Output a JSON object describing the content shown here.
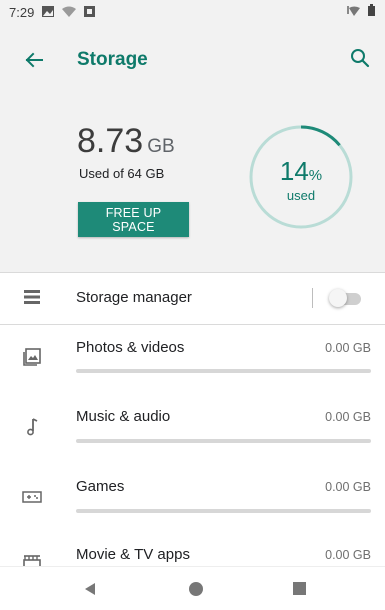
{
  "status_bar": {
    "time": "7:29",
    "icons": [
      "image-icon",
      "wifi-icon",
      "notification-icon",
      "signal-icon",
      "battery-icon"
    ]
  },
  "header": {
    "title": "Storage",
    "back_icon": "arrow-left-icon",
    "search_icon": "search-icon",
    "accent_color": "#0e7a6a",
    "background": "#f2f2f2"
  },
  "summary": {
    "used_value": "8.73",
    "used_unit": "GB",
    "used_of": "Used of 64 GB",
    "button_label": "FREE UP SPACE",
    "button_color": "#1e8a78",
    "percent_value": "14",
    "percent_sign": "%",
    "percent_label": "used",
    "percent_fraction": 0.14,
    "ring_track_color": "#b9dcd6",
    "ring_fill_color": "#1e8a78"
  },
  "storage_manager": {
    "label": "Storage manager",
    "icon": "storage-list-icon",
    "enabled": false
  },
  "categories": [
    {
      "label": "Photos & videos",
      "size": "0.00 GB",
      "icon": "photo-icon",
      "fraction": 0
    },
    {
      "label": "Music & audio",
      "size": "0.00 GB",
      "icon": "music-note-icon",
      "fraction": 0
    },
    {
      "label": "Games",
      "size": "0.00 GB",
      "icon": "gamepad-icon",
      "fraction": 0
    },
    {
      "label": "Movie & TV apps",
      "size": "0.00 GB",
      "icon": "movie-icon",
      "fraction": 0
    }
  ],
  "nav_bar": {
    "icons": [
      "back-triangle-icon",
      "home-circle-icon",
      "recents-square-icon"
    ]
  }
}
